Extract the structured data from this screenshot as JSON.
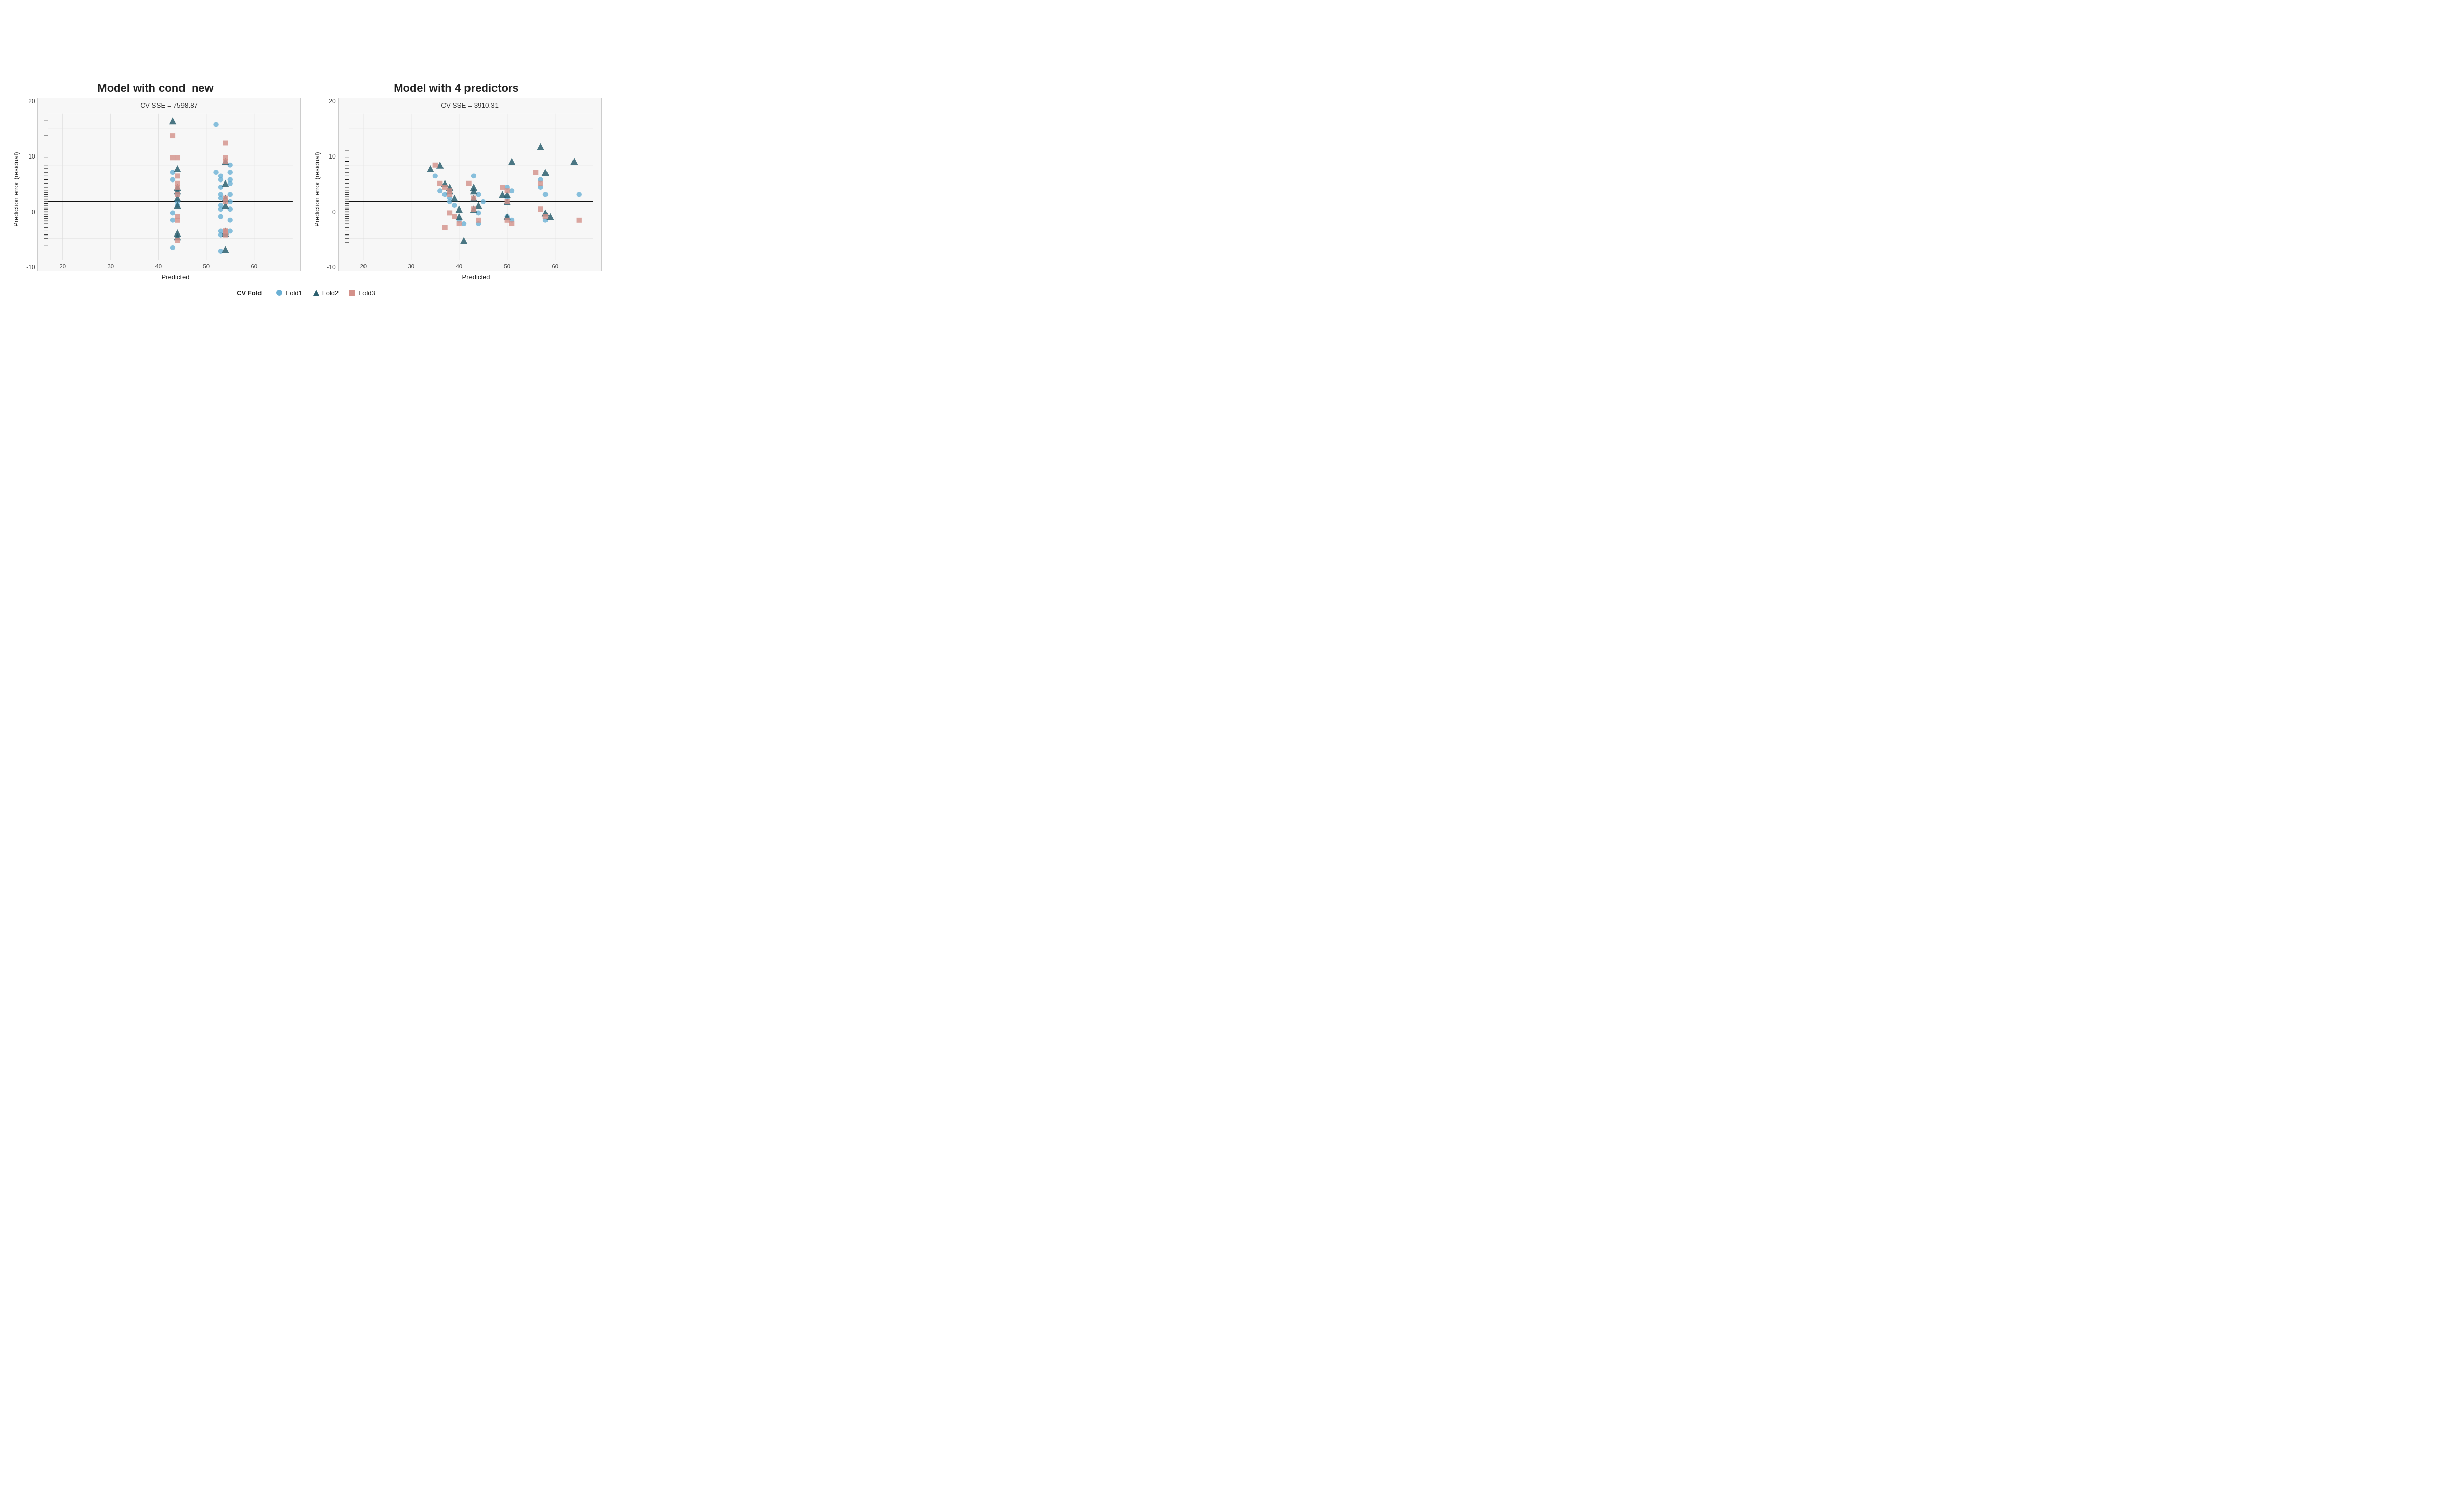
{
  "charts": [
    {
      "id": "chart1",
      "title": "Model with cond_new",
      "cv_sse": "CV SSE = 7598.87",
      "x_axis_label": "Predicted",
      "y_axis_label": "Prediction error (residual)",
      "x_min": 17,
      "x_max": 68,
      "y_min": -16,
      "y_max": 24,
      "x_ticks": [
        20,
        30,
        40,
        50,
        60
      ],
      "y_ticks": [
        -10,
        0,
        10,
        20
      ],
      "fold1_color": "#6ab0d4",
      "fold2_color": "#2b5f6e",
      "fold3_color": "#d4918a",
      "fold1_shape": "circle",
      "fold2_shape": "triangle",
      "fold3_shape": "square",
      "fold1_points": [
        [
          43,
          8
        ],
        [
          43,
          6
        ],
        [
          44,
          2
        ],
        [
          44,
          0
        ],
        [
          44,
          -1
        ],
        [
          43,
          -3
        ],
        [
          43,
          -5
        ],
        [
          43,
          -12.5
        ],
        [
          52,
          21
        ],
        [
          52,
          8
        ],
        [
          53,
          7
        ],
        [
          53,
          6
        ],
        [
          53,
          4
        ],
        [
          53,
          2
        ],
        [
          53,
          1
        ],
        [
          53,
          -1
        ],
        [
          53,
          -2
        ],
        [
          53,
          -4
        ],
        [
          53,
          -8
        ],
        [
          53,
          -9
        ],
        [
          53,
          -13.5
        ],
        [
          55,
          10
        ],
        [
          55,
          8
        ],
        [
          55,
          6
        ],
        [
          55,
          5
        ],
        [
          55,
          2
        ],
        [
          55,
          0
        ],
        [
          55,
          -2
        ],
        [
          55,
          -5
        ],
        [
          55,
          -8
        ]
      ],
      "fold2_points": [
        [
          43,
          22
        ],
        [
          44,
          9
        ],
        [
          44,
          4
        ],
        [
          44,
          3
        ],
        [
          44,
          1
        ],
        [
          44,
          -1
        ],
        [
          44,
          -8.5
        ],
        [
          44,
          -9.5
        ],
        [
          54,
          11
        ],
        [
          54,
          5
        ],
        [
          54,
          1
        ],
        [
          54,
          -1
        ],
        [
          54,
          -8
        ],
        [
          54,
          -8.5
        ],
        [
          54,
          -13
        ]
      ],
      "fold3_points": [
        [
          43,
          18
        ],
        [
          43,
          12
        ],
        [
          44,
          12
        ],
        [
          44,
          7
        ],
        [
          44,
          5
        ],
        [
          44,
          4
        ],
        [
          44,
          2
        ],
        [
          44,
          -4
        ],
        [
          44,
          -5
        ],
        [
          44,
          -10.5
        ],
        [
          54,
          16
        ],
        [
          54,
          12
        ],
        [
          54,
          11
        ],
        [
          54,
          1
        ],
        [
          54,
          0
        ],
        [
          54,
          -8
        ],
        [
          54,
          -8
        ],
        [
          54,
          -9
        ]
      ],
      "rug_points": [
        -12,
        -10,
        -9,
        -8,
        -7,
        -6,
        -5.5,
        -5,
        -4.5,
        -4,
        -3.5,
        -3,
        -2.5,
        -2,
        -1.5,
        -1,
        -0.5,
        0,
        0.5,
        1,
        1.5,
        2,
        2.5,
        3,
        4,
        5,
        6,
        7,
        8,
        9,
        10,
        12,
        18,
        22
      ]
    },
    {
      "id": "chart2",
      "title": "Model with 4 predictors",
      "cv_sse": "CV SSE = 3910.31",
      "x_axis_label": "Predicted",
      "y_axis_label": "Prediction error (residual)",
      "x_min": 17,
      "x_max": 68,
      "y_min": -16,
      "y_max": 24,
      "x_ticks": [
        20,
        30,
        40,
        50,
        60
      ],
      "y_ticks": [
        -10,
        0,
        10,
        20
      ],
      "fold1_color": "#6ab0d4",
      "fold2_color": "#2b5f6e",
      "fold3_color": "#d4918a",
      "fold1_shape": "circle",
      "fold2_shape": "triangle",
      "fold3_shape": "square",
      "fold1_points": [
        [
          35,
          7
        ],
        [
          36,
          3
        ],
        [
          37,
          2
        ],
        [
          38,
          1
        ],
        [
          38,
          0
        ],
        [
          39,
          -1
        ],
        [
          40,
          -5
        ],
        [
          41,
          -6
        ],
        [
          43,
          7
        ],
        [
          44,
          2
        ],
        [
          44,
          -3
        ],
        [
          44,
          -6
        ],
        [
          45,
          0
        ],
        [
          50,
          4
        ],
        [
          50,
          1
        ],
        [
          50,
          -4
        ],
        [
          51,
          3
        ],
        [
          51,
          -5
        ],
        [
          57,
          6
        ],
        [
          57,
          4
        ],
        [
          58,
          2
        ],
        [
          58,
          -5
        ],
        [
          65,
          2
        ]
      ],
      "fold2_points": [
        [
          34,
          9
        ],
        [
          36,
          10
        ],
        [
          37,
          5
        ],
        [
          38,
          4
        ],
        [
          38,
          3
        ],
        [
          39,
          1
        ],
        [
          40,
          -2
        ],
        [
          40,
          -4
        ],
        [
          41,
          -10.5
        ],
        [
          43,
          4
        ],
        [
          43,
          3
        ],
        [
          43,
          1
        ],
        [
          43,
          -2
        ],
        [
          44,
          -1
        ],
        [
          49,
          2
        ],
        [
          50,
          2
        ],
        [
          50,
          0
        ],
        [
          50,
          -4
        ],
        [
          51,
          11
        ],
        [
          57,
          15
        ],
        [
          58,
          8
        ],
        [
          58,
          -3
        ],
        [
          59,
          -4
        ],
        [
          64,
          11
        ]
      ],
      "fold3_points": [
        [
          35,
          10
        ],
        [
          36,
          5
        ],
        [
          37,
          4
        ],
        [
          37,
          -7
        ],
        [
          38,
          3
        ],
        [
          38,
          2
        ],
        [
          38,
          -3
        ],
        [
          39,
          -4
        ],
        [
          40,
          -6
        ],
        [
          42,
          5
        ],
        [
          43,
          1
        ],
        [
          43,
          -2
        ],
        [
          44,
          -5
        ],
        [
          49,
          4
        ],
        [
          50,
          3
        ],
        [
          50,
          0
        ],
        [
          50,
          -5
        ],
        [
          51,
          -6
        ],
        [
          56,
          8
        ],
        [
          57,
          5
        ],
        [
          57,
          -2
        ],
        [
          58,
          -4
        ],
        [
          65,
          -5
        ]
      ],
      "rug_points": [
        -11,
        -10,
        -9,
        -8,
        -7,
        -6,
        -5.5,
        -5,
        -4.5,
        -4,
        -3.5,
        -3,
        -2.5,
        -2,
        -1.5,
        -1,
        -0.5,
        0,
        0.5,
        1,
        1.5,
        2,
        2.5,
        3,
        4,
        5,
        6,
        7,
        8,
        9,
        10,
        11,
        12,
        14
      ]
    }
  ],
  "legend": {
    "title": "CV Fold",
    "items": [
      {
        "label": "Fold1",
        "shape": "circle",
        "color": "#6ab0d4"
      },
      {
        "label": "Fold2",
        "shape": "triangle",
        "color": "#2b5f6e"
      },
      {
        "label": "Fold3",
        "shape": "square",
        "color": "#d4918a"
      }
    ]
  }
}
